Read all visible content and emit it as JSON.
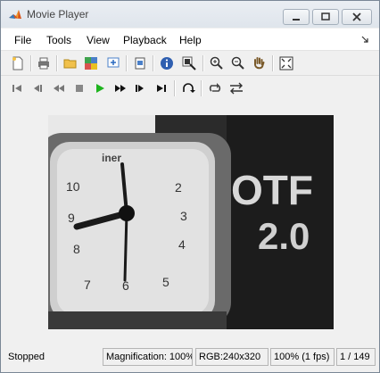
{
  "window": {
    "title": "Movie Player"
  },
  "menu": {
    "items": [
      "File",
      "Tools",
      "View",
      "Playback",
      "Help"
    ]
  },
  "toolbar1": {
    "icons": [
      "new-icon",
      "print-icon",
      "open-folder-icon",
      "export-icon",
      "import-icon",
      "properties-icon",
      "info-icon",
      "pixel-info-icon",
      "zoom-in-icon",
      "zoom-out-icon",
      "pan-hand-icon",
      "fit-to-window-icon"
    ]
  },
  "toolbar2": {
    "icons": [
      "go-to-first-icon",
      "step-back-icon",
      "rewind-icon",
      "stop-icon",
      "play-icon",
      "fast-forward-icon",
      "step-forward-icon",
      "go-to-last-icon",
      "jump-to-icon",
      "loop-icon",
      "playback-direction-icon"
    ]
  },
  "status": {
    "state": "Stopped",
    "magnification": "Magnification: 100%",
    "rgb": "RGB:240x320",
    "rate": "100% (1 fps)",
    "frame": "1 / 149"
  }
}
